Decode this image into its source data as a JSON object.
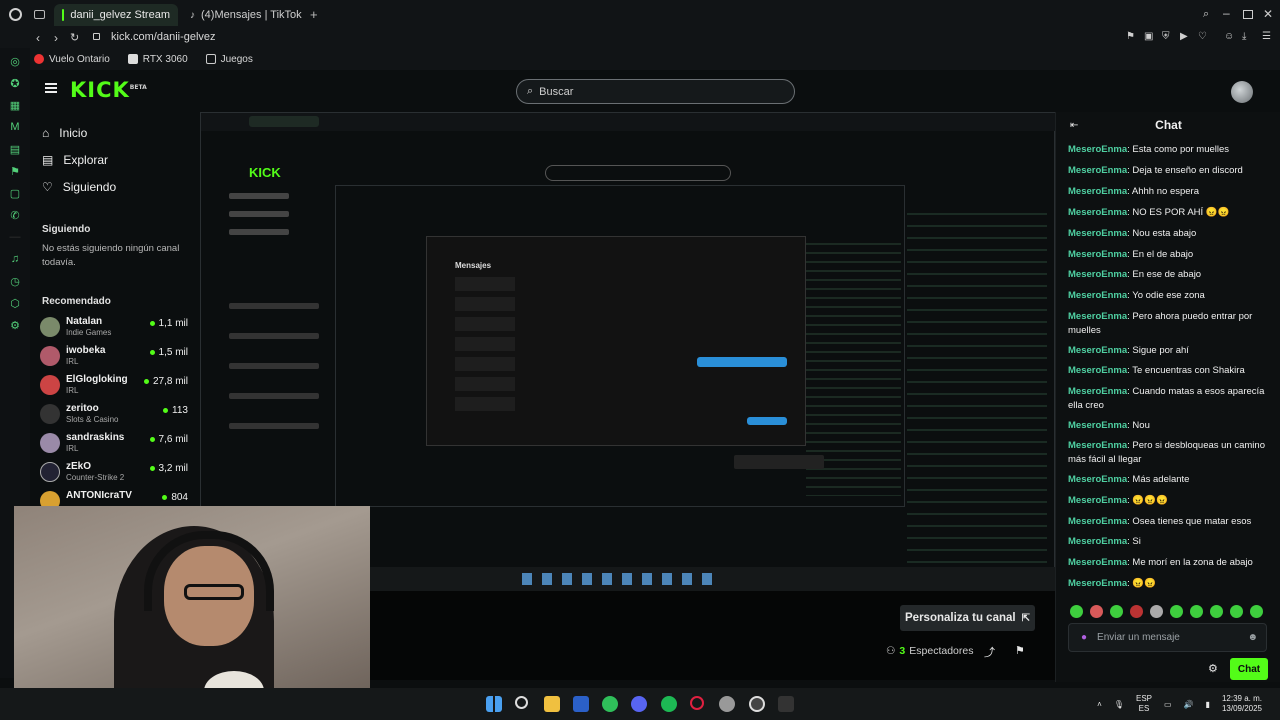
{
  "browser": {
    "tabs": [
      {
        "label": "danii_gelvez Stream",
        "active": true
      },
      {
        "label": "(4)Mensajes | TikTok",
        "active": false
      }
    ],
    "url": "kick.com/danii-gelvez",
    "bookmarks": [
      "Vuelo Ontario",
      "RTX 3060",
      "Juegos"
    ]
  },
  "header": {
    "logo": "KICK",
    "logo_badge": "BETA",
    "search_placeholder": "Buscar"
  },
  "nav": {
    "items": [
      "Inicio",
      "Explorar",
      "Siguiendo"
    ],
    "following_title": "Siguiendo",
    "following_empty": "No estás siguiendo ningún canal todavía.",
    "recommended_title": "Recomendado",
    "recommended": [
      {
        "name": "Natalan",
        "category": "Indie Games",
        "viewers": "1,1 mil"
      },
      {
        "name": "iwobeka",
        "category": "IRL",
        "viewers": "1,5 mil"
      },
      {
        "name": "ElGlogloking",
        "category": "IRL",
        "viewers": "27,8 mil"
      },
      {
        "name": "zeritoo",
        "category": "Slots & Casino",
        "viewers": "113"
      },
      {
        "name": "sandraskins",
        "category": "IRL",
        "viewers": "7,6 mil"
      },
      {
        "name": "zEkO",
        "category": "Counter-Strike 2",
        "viewers": "3,2 mil"
      },
      {
        "name": "ANTONIcraTV",
        "category": "",
        "viewers": "804"
      }
    ]
  },
  "stream": {
    "customize_label": "Personaliza tu canal",
    "viewers_count": "3",
    "viewers_label": "Espectadores",
    "inner_tiktok_title": "Mensajes"
  },
  "chat": {
    "title": "Chat",
    "messages": [
      {
        "user": "MeseroEnma",
        "text": "Esta como por muelles"
      },
      {
        "user": "MeseroEnma",
        "text": "Deja te enseño en discord"
      },
      {
        "user": "MeseroEnma",
        "text": "Ahhh no espera"
      },
      {
        "user": "MeseroEnma",
        "text": "NO ES POR AHÍ 😠😠"
      },
      {
        "user": "MeseroEnma",
        "text": "Nou esta abajo"
      },
      {
        "user": "MeseroEnma",
        "text": "En el de abajo"
      },
      {
        "user": "MeseroEnma",
        "text": "En ese de abajo"
      },
      {
        "user": "MeseroEnma",
        "text": "Yo odie ese zona"
      },
      {
        "user": "MeseroEnma",
        "text": "Pero ahora puedo entrar por muelles"
      },
      {
        "user": "MeseroEnma",
        "text": "Sigue por ahí"
      },
      {
        "user": "MeseroEnma",
        "text": "Te encuentras con Shakira"
      },
      {
        "user": "MeseroEnma",
        "text": "Cuando matas a esos aparecía ella creo"
      },
      {
        "user": "MeseroEnma",
        "text": "Nou"
      },
      {
        "user": "MeseroEnma",
        "text": "Pero si desbloqueas un camino más fácil al llegar"
      },
      {
        "user": "MeseroEnma",
        "text": "Más adelante"
      },
      {
        "user": "MeseroEnma",
        "text": "😠😠😠"
      },
      {
        "user": "MeseroEnma",
        "text": "Osea tienes que matar esos"
      },
      {
        "user": "MeseroEnma",
        "text": "Si"
      },
      {
        "user": "MeseroEnma",
        "text": "Me morí en la zona de abajo"
      },
      {
        "user": "MeseroEnma",
        "text": "😠😠"
      }
    ],
    "input_placeholder": "Enviar un mensaje",
    "send_label": "Chat"
  },
  "taskbar": {
    "lang_top": "ESP",
    "lang_bottom": "ES",
    "time": "12:39 a. m.",
    "date": "13/09/2025"
  }
}
